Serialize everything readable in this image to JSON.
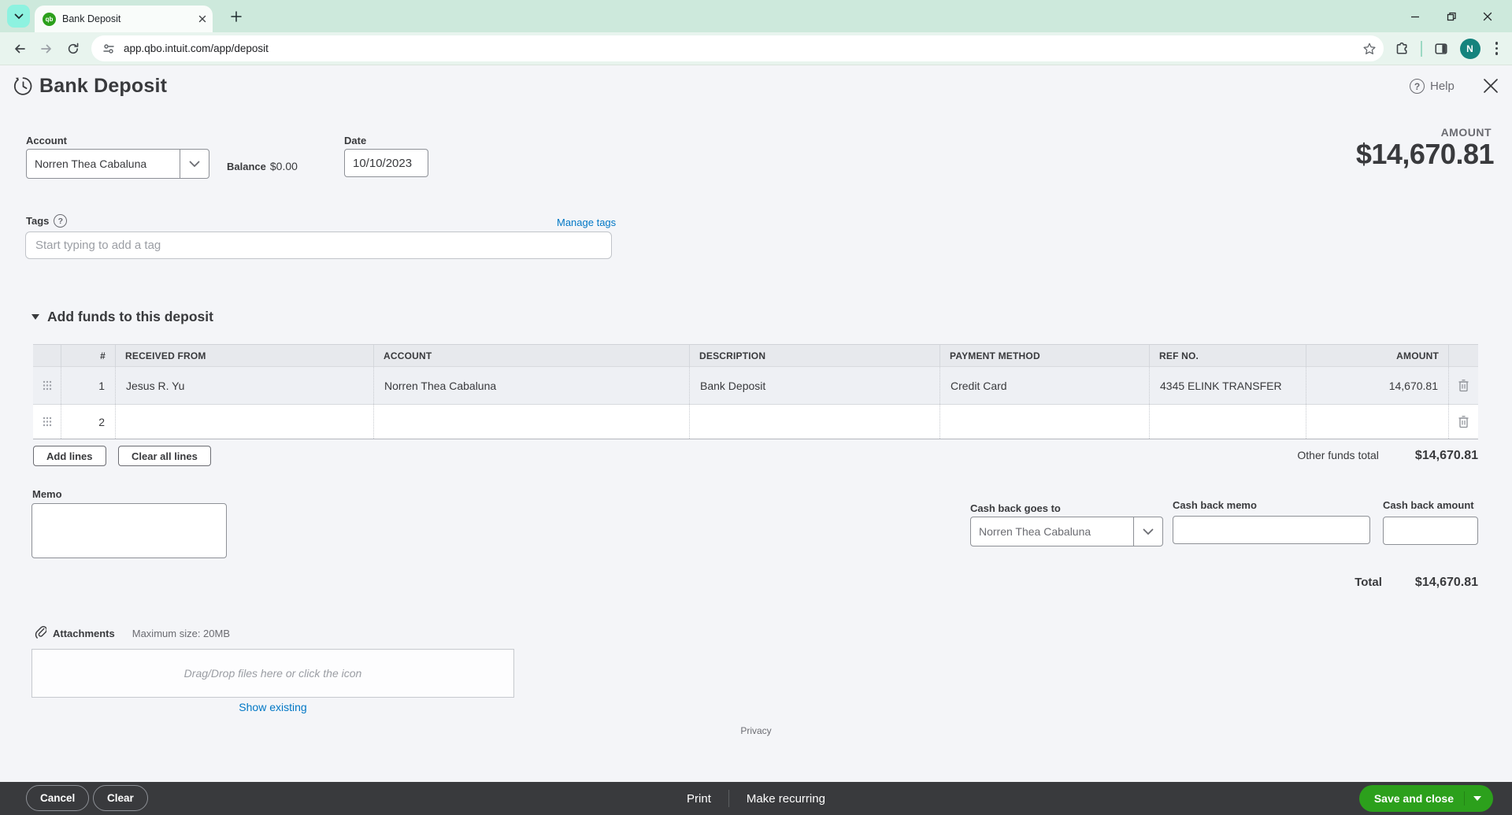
{
  "browser": {
    "tab_title": "Bank Deposit",
    "url": "app.qbo.intuit.com/app/deposit",
    "favicon_text": "qb",
    "avatar_letter": "N"
  },
  "header": {
    "title": "Bank Deposit",
    "help_label": "Help",
    "help_glyph": "?"
  },
  "form": {
    "account_label": "Account",
    "account_value": "Norren Thea Cabaluna",
    "balance_label": "Balance",
    "balance_value": "$0.00",
    "date_label": "Date",
    "date_value": "10/10/2023",
    "amount_label": "AMOUNT",
    "amount_value": "$14,670.81",
    "tags_label": "Tags",
    "tags_help_glyph": "?",
    "manage_tags_label": "Manage tags",
    "tags_placeholder": "Start typing to add a tag"
  },
  "funds": {
    "title": "Add funds to this deposit",
    "columns": [
      "#",
      "RECEIVED FROM",
      "ACCOUNT",
      "DESCRIPTION",
      "PAYMENT METHOD",
      "REF NO.",
      "AMOUNT"
    ],
    "rows": [
      {
        "num": "1",
        "received_from": "Jesus R. Yu",
        "account": "Norren Thea Cabaluna",
        "description": "Bank Deposit",
        "payment_method": "Credit Card",
        "ref_no": "4345 ELINK TRANSFER",
        "amount": "14,670.81"
      },
      {
        "num": "2",
        "received_from": "",
        "account": "",
        "description": "",
        "payment_method": "",
        "ref_no": "",
        "amount": ""
      }
    ],
    "add_lines_label": "Add lines",
    "clear_all_lines_label": "Clear all lines",
    "other_funds_total_label": "Other funds total",
    "other_funds_total_value": "$14,670.81"
  },
  "memo": {
    "label": "Memo"
  },
  "cash_back": {
    "goes_to_label": "Cash back goes to",
    "goes_to_value": "Norren Thea Cabaluna",
    "memo_label": "Cash back memo",
    "amount_label": "Cash back amount"
  },
  "totals": {
    "total_label": "Total",
    "total_value": "$14,670.81"
  },
  "attachments": {
    "label": "Attachments",
    "max_size": "Maximum size: 20MB",
    "dropzone_text": "Drag/Drop files here or click the icon",
    "show_existing_label": "Show existing"
  },
  "privacy_label": "Privacy",
  "footer": {
    "cancel_label": "Cancel",
    "clear_label": "Clear",
    "print_label": "Print",
    "make_recurring_label": "Make recurring",
    "save_label": "Save and close"
  },
  "colors": {
    "accent_green": "#2ca01c",
    "link_blue": "#0077c5",
    "footer_bg": "#393a3d",
    "avatar_teal": "#15837d",
    "chrome_mint": "#cde9dc"
  }
}
